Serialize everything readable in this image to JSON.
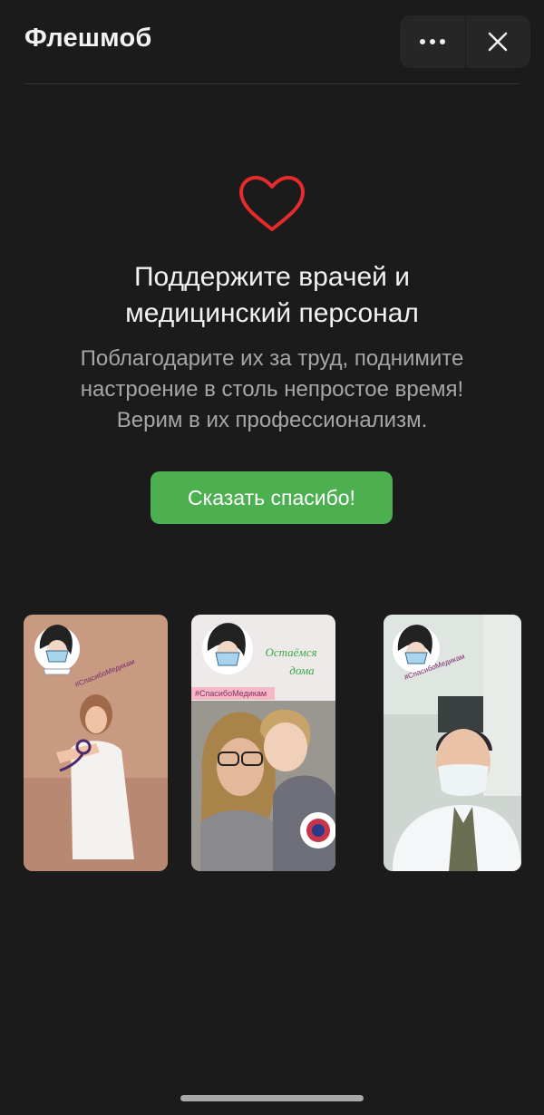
{
  "header": {
    "title": "Флешмоб",
    "more_icon": "more-dots-icon",
    "close_icon": "close-icon"
  },
  "hero": {
    "icon": "heart-icon",
    "headline_line1": "Поддержите врачей и",
    "headline_line2": "медицинский персонал",
    "subtext_line1": "Поблагодарите их за труд, поднимите",
    "subtext_line2": "настроение в столь непростое время!",
    "subtext_line3": "Верим в их профессионализм.",
    "cta_label": "Сказать спасибо!"
  },
  "stories": [
    {
      "sticker_text": "#СпасибоМедикам",
      "caption": ""
    },
    {
      "sticker_text": "#СпасибоМедикам",
      "caption_line1": "Остаёмся",
      "caption_line2": "дома"
    },
    {
      "sticker_text": "#СпасибоМедикам",
      "caption": ""
    }
  ],
  "colors": {
    "background": "#1b1b1b",
    "accent_green": "#4caf50",
    "heart_red": "#e52b2b",
    "secondary_text": "#a6a6a6"
  }
}
